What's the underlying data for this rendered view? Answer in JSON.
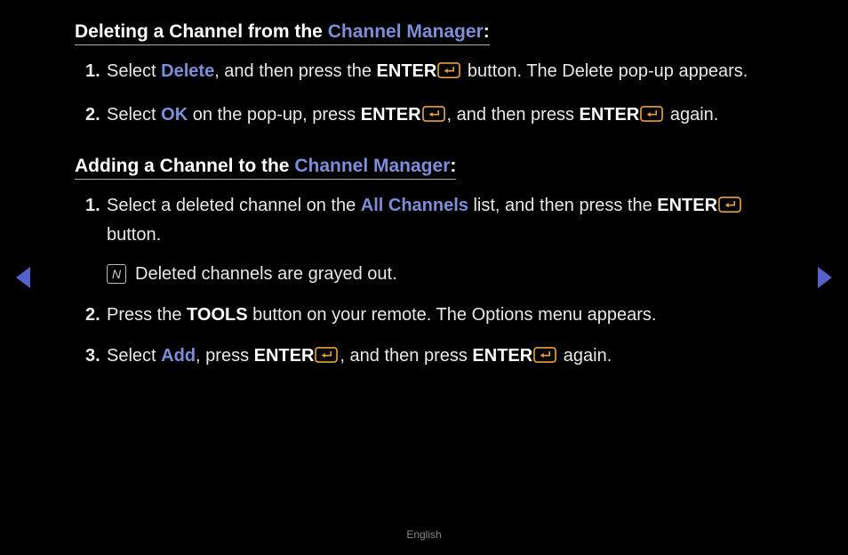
{
  "section1": {
    "heading_a": "Deleting a Channel from the ",
    "heading_b": "Channel Manager",
    "heading_c": ":",
    "steps": [
      {
        "num": "1.",
        "t1": "Select ",
        "hl1": "Delete",
        "t2": ", and then press the ",
        "kw1": "ENTER",
        "t3": " button. The Delete pop-up appears."
      },
      {
        "num": "2.",
        "t1": "Select ",
        "hl1": "OK",
        "t2": " on the pop-up, press ",
        "kw1": "ENTER",
        "t3": ", and then press ",
        "kw2": "ENTER",
        "t4": " again."
      }
    ]
  },
  "section2": {
    "heading_a": "Adding a Channel to the ",
    "heading_b": "Channel Manager",
    "heading_c": ":",
    "steps": [
      {
        "num": "1.",
        "t1": "Select a deleted channel on the ",
        "hl1": "All Channels",
        "t2": " list, and then press the ",
        "kw1": "ENTER",
        "t3": " button.",
        "note": "Deleted channels are grayed out."
      },
      {
        "num": "2.",
        "t1": "Press the ",
        "kw0": "TOOLS",
        "t2": " button on your remote. The Options menu appears."
      },
      {
        "num": "3.",
        "t1": "Select ",
        "hl1": "Add",
        "t2": ", press ",
        "kw1": "ENTER",
        "t3": ", and then press ",
        "kw2": "ENTER",
        "t4": " again."
      }
    ]
  },
  "footer": "English",
  "icons": {
    "enter": "enter-icon",
    "note": "N"
  }
}
